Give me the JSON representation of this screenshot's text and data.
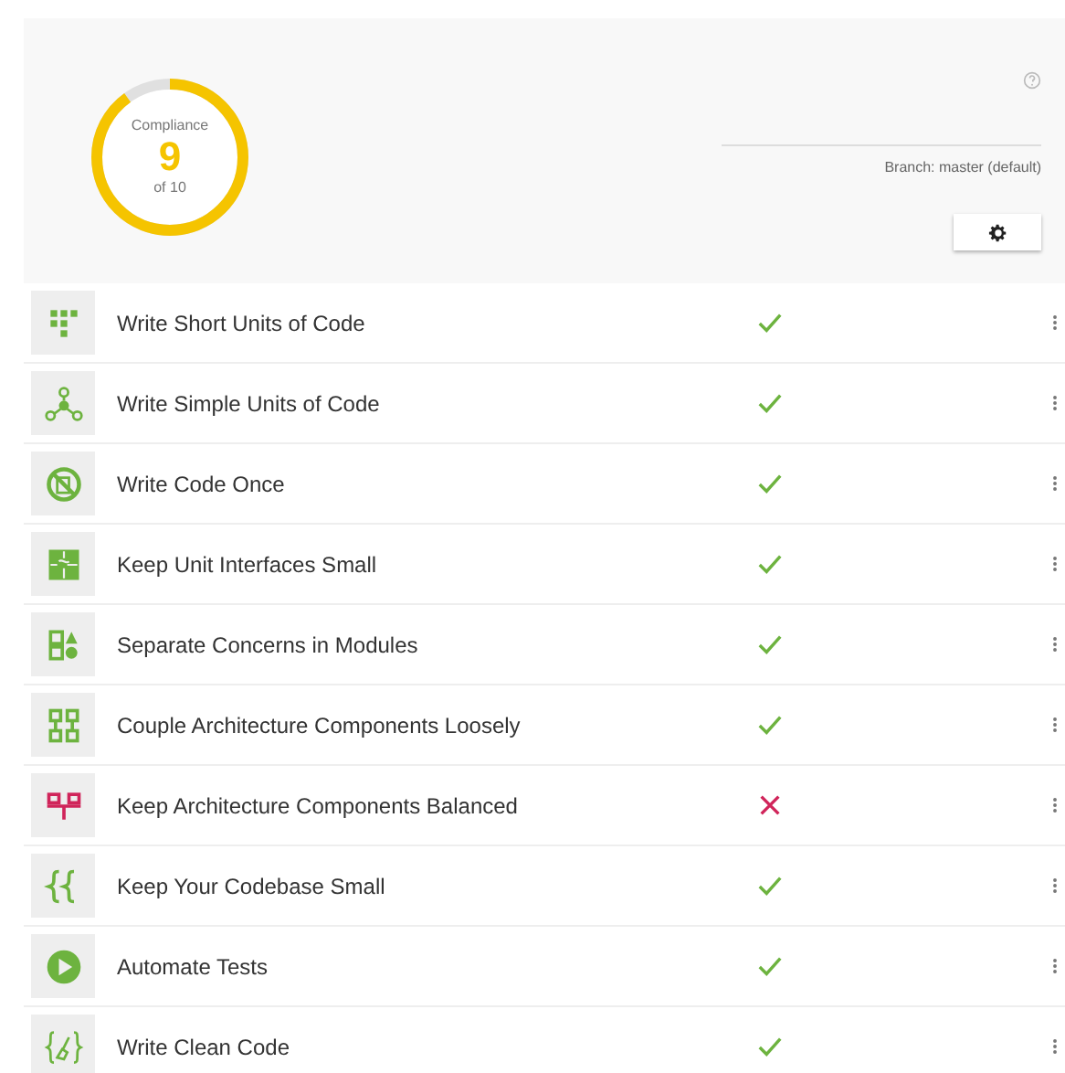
{
  "compliance": {
    "label": "Compliance",
    "score": "9",
    "total": "of 10"
  },
  "branch": "Branch: master (default)",
  "guidelines": [
    {
      "title": "Write Short Units of Code",
      "compliant": true
    },
    {
      "title": "Write Simple Units of Code",
      "compliant": true
    },
    {
      "title": "Write Code Once",
      "compliant": true
    },
    {
      "title": "Keep Unit Interfaces Small",
      "compliant": true
    },
    {
      "title": "Separate Concerns in Modules",
      "compliant": true
    },
    {
      "title": "Couple Architecture Components Loosely",
      "compliant": true
    },
    {
      "title": "Keep Architecture Components Balanced",
      "compliant": false
    },
    {
      "title": "Keep Your Codebase Small",
      "compliant": true
    },
    {
      "title": "Automate Tests",
      "compliant": true
    },
    {
      "title": "Write Clean Code",
      "compliant": true
    }
  ]
}
